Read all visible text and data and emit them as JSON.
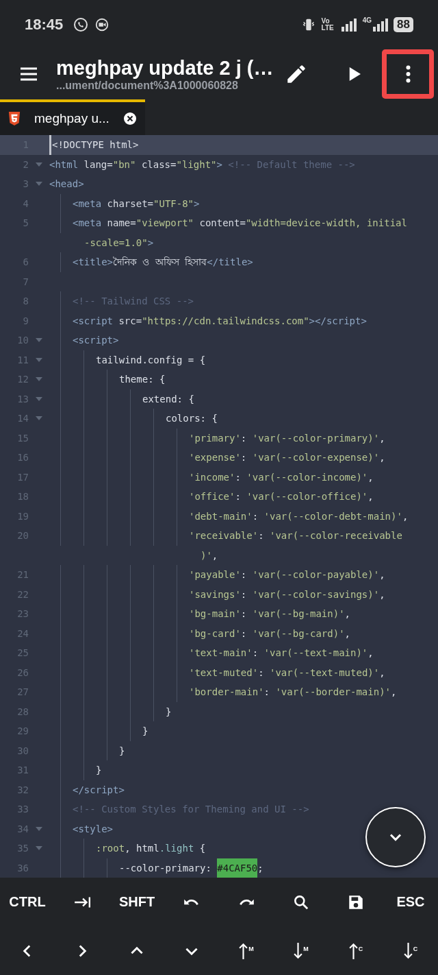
{
  "status_bar": {
    "time": "18:45",
    "volte_top": "Vo",
    "volte_bottom": "LTE",
    "network": "4G",
    "battery": "88"
  },
  "app_bar": {
    "title": "meghpay update 2 j (…",
    "subtitle": "...ument/document%3A1000060828",
    "menu_button_highlighted": true
  },
  "tabs": [
    {
      "label": "meghpay u...",
      "selected": true
    }
  ],
  "lines": [
    {
      "number": "1",
      "foldable": false,
      "current": true,
      "tokens": [
        {
          "kind": "p",
          "text": "<!DOCTYPE html>"
        }
      ]
    },
    {
      "number": "2",
      "foldable": true,
      "current": false,
      "tokens": [
        {
          "kind": "t",
          "text": "<html"
        },
        {
          "kind": "a",
          "text": " lang"
        },
        {
          "kind": "p",
          "text": "="
        },
        {
          "kind": "s",
          "text": "\"bn\""
        },
        {
          "kind": "a",
          "text": " class"
        },
        {
          "kind": "p",
          "text": "="
        },
        {
          "kind": "s",
          "text": "\"light\""
        },
        {
          "kind": "t",
          "text": ">"
        },
        {
          "kind": "c",
          "text": " <!-- Default theme -->"
        }
      ]
    },
    {
      "number": "3",
      "foldable": true,
      "current": false,
      "tokens": [
        {
          "kind": "t",
          "text": "<head>"
        }
      ],
      "children": [
        {
          "number": "4",
          "foldable": false,
          "current": false,
          "tokens": [
            {
              "kind": "t",
              "text": "<meta"
            },
            {
              "kind": "a",
              "text": " charset"
            },
            {
              "kind": "p",
              "text": "="
            },
            {
              "kind": "s",
              "text": "\"UTF-8\""
            },
            {
              "kind": "t",
              "text": ">"
            }
          ]
        },
        {
          "number": "5",
          "foldable": false,
          "current": false,
          "tokens": [
            {
              "kind": "t",
              "text": "<meta"
            },
            {
              "kind": "a",
              "text": " name"
            },
            {
              "kind": "p",
              "text": "="
            },
            {
              "kind": "s",
              "text": "\"viewport\""
            },
            {
              "kind": "a",
              "text": " content"
            },
            {
              "kind": "p",
              "text": "="
            },
            {
              "kind": "s",
              "text": "\"width=device-width, initial"
            }
          ],
          "continuation": [
            {
              "kind": "s",
              "text": "-scale=1.0\""
            },
            {
              "kind": "t",
              "text": ">"
            }
          ]
        },
        {
          "number": "6",
          "foldable": false,
          "current": false,
          "tokens": [
            {
              "kind": "t",
              "text": "<title>"
            },
            {
              "kind": "p",
              "text": "দৈনিক ও অফিস হিসাব"
            },
            {
              "kind": "t",
              "text": "</title>"
            }
          ]
        },
        {
          "number": "7",
          "foldable": false,
          "current": false
        },
        {
          "number": "8",
          "foldable": false,
          "current": false,
          "tokens": [
            {
              "kind": "c",
              "text": "<!-- Tailwind CSS -->"
            }
          ]
        },
        {
          "number": "9",
          "foldable": false,
          "current": false,
          "tokens": [
            {
              "kind": "t",
              "text": "<script"
            },
            {
              "kind": "a",
              "text": " src"
            },
            {
              "kind": "p",
              "text": "="
            },
            {
              "kind": "s",
              "text": "\"https://cdn.tailwindcss.com\""
            },
            {
              "kind": "t",
              "text": "></script>"
            }
          ]
        },
        {
          "number": "10",
          "foldable": true,
          "current": false,
          "tokens": [
            {
              "kind": "t",
              "text": "<script>"
            }
          ],
          "children": [
            {
              "number": "11",
              "foldable": true,
              "current": false,
              "tokens": [
                {
                  "kind": "p",
                  "text": "tailwind.config = {"
                }
              ],
              "children": [
                {
                  "number": "12",
                  "foldable": true,
                  "current": false,
                  "tokens": [
                    {
                      "kind": "p",
                      "text": "theme: {"
                    }
                  ],
                  "children": [
                    {
                      "number": "13",
                      "foldable": true,
                      "current": false,
                      "tokens": [
                        {
                          "kind": "p",
                          "text": "extend: {"
                        }
                      ],
                      "children": [
                        {
                          "number": "14",
                          "foldable": true,
                          "current": false,
                          "tokens": [
                            {
                              "kind": "p",
                              "text": "colors: {"
                            }
                          ],
                          "children": [
                            {
                              "number": "15",
                              "foldable": false,
                              "current": false,
                              "tokens": [
                                {
                                  "kind": "s",
                                  "text": "'primary'"
                                },
                                {
                                  "kind": "p",
                                  "text": ": "
                                },
                                {
                                  "kind": "s",
                                  "text": "'var(--color-primary)'"
                                },
                                {
                                  "kind": "p",
                                  "text": ","
                                }
                              ]
                            },
                            {
                              "number": "16",
                              "foldable": false,
                              "current": false,
                              "tokens": [
                                {
                                  "kind": "s",
                                  "text": "'expense'"
                                },
                                {
                                  "kind": "p",
                                  "text": ": "
                                },
                                {
                                  "kind": "s",
                                  "text": "'var(--color-expense)'"
                                },
                                {
                                  "kind": "p",
                                  "text": ","
                                }
                              ]
                            },
                            {
                              "number": "17",
                              "foldable": false,
                              "current": false,
                              "tokens": [
                                {
                                  "kind": "s",
                                  "text": "'income'"
                                },
                                {
                                  "kind": "p",
                                  "text": ": "
                                },
                                {
                                  "kind": "s",
                                  "text": "'var(--color-income)'"
                                },
                                {
                                  "kind": "p",
                                  "text": ","
                                }
                              ]
                            },
                            {
                              "number": "18",
                              "foldable": false,
                              "current": false,
                              "tokens": [
                                {
                                  "kind": "s",
                                  "text": "'office'"
                                },
                                {
                                  "kind": "p",
                                  "text": ": "
                                },
                                {
                                  "kind": "s",
                                  "text": "'var(--color-office)'"
                                },
                                {
                                  "kind": "p",
                                  "text": ","
                                }
                              ]
                            },
                            {
                              "number": "19",
                              "foldable": false,
                              "current": false,
                              "tokens": [
                                {
                                  "kind": "s",
                                  "text": "'debt-main'"
                                },
                                {
                                  "kind": "p",
                                  "text": ": "
                                },
                                {
                                  "kind": "s",
                                  "text": "'var(--color-debt-main)'"
                                },
                                {
                                  "kind": "p",
                                  "text": ","
                                }
                              ]
                            },
                            {
                              "number": "20",
                              "foldable": false,
                              "current": false,
                              "tokens": [
                                {
                                  "kind": "s",
                                  "text": "'receivable'"
                                },
                                {
                                  "kind": "p",
                                  "text": ": "
                                },
                                {
                                  "kind": "s",
                                  "text": "'var(--color-receivable"
                                }
                              ],
                              "continuation": [
                                {
                                  "kind": "s",
                                  "text": ")'"
                                },
                                {
                                  "kind": "p",
                                  "text": ","
                                }
                              ]
                            },
                            {
                              "number": "21",
                              "foldable": false,
                              "current": false,
                              "tokens": [
                                {
                                  "kind": "s",
                                  "text": "'payable'"
                                },
                                {
                                  "kind": "p",
                                  "text": ": "
                                },
                                {
                                  "kind": "s",
                                  "text": "'var(--color-payable)'"
                                },
                                {
                                  "kind": "p",
                                  "text": ","
                                }
                              ]
                            },
                            {
                              "number": "22",
                              "foldable": false,
                              "current": false,
                              "tokens": [
                                {
                                  "kind": "s",
                                  "text": "'savings'"
                                },
                                {
                                  "kind": "p",
                                  "text": ": "
                                },
                                {
                                  "kind": "s",
                                  "text": "'var(--color-savings)'"
                                },
                                {
                                  "kind": "p",
                                  "text": ","
                                }
                              ]
                            },
                            {
                              "number": "23",
                              "foldable": false,
                              "current": false,
                              "tokens": [
                                {
                                  "kind": "s",
                                  "text": "'bg-main'"
                                },
                                {
                                  "kind": "p",
                                  "text": ": "
                                },
                                {
                                  "kind": "s",
                                  "text": "'var(--bg-main)'"
                                },
                                {
                                  "kind": "p",
                                  "text": ","
                                }
                              ]
                            },
                            {
                              "number": "24",
                              "foldable": false,
                              "current": false,
                              "tokens": [
                                {
                                  "kind": "s",
                                  "text": "'bg-card'"
                                },
                                {
                                  "kind": "p",
                                  "text": ": "
                                },
                                {
                                  "kind": "s",
                                  "text": "'var(--bg-card)'"
                                },
                                {
                                  "kind": "p",
                                  "text": ","
                                }
                              ]
                            },
                            {
                              "number": "25",
                              "foldable": false,
                              "current": false,
                              "tokens": [
                                {
                                  "kind": "s",
                                  "text": "'text-main'"
                                },
                                {
                                  "kind": "p",
                                  "text": ": "
                                },
                                {
                                  "kind": "s",
                                  "text": "'var(--text-main)'"
                                },
                                {
                                  "kind": "p",
                                  "text": ","
                                }
                              ]
                            },
                            {
                              "number": "26",
                              "foldable": false,
                              "current": false,
                              "tokens": [
                                {
                                  "kind": "s",
                                  "text": "'text-muted'"
                                },
                                {
                                  "kind": "p",
                                  "text": ": "
                                },
                                {
                                  "kind": "s",
                                  "text": "'var(--text-muted)'"
                                },
                                {
                                  "kind": "p",
                                  "text": ","
                                }
                              ]
                            },
                            {
                              "number": "27",
                              "foldable": false,
                              "current": false,
                              "tokens": [
                                {
                                  "kind": "s",
                                  "text": "'border-main'"
                                },
                                {
                                  "kind": "p",
                                  "text": ": "
                                },
                                {
                                  "kind": "s",
                                  "text": "'var(--border-main)'"
                                },
                                {
                                  "kind": "p",
                                  "text": ","
                                }
                              ]
                            }
                          ]
                        },
                        {
                          "number": "28",
                          "foldable": false,
                          "current": false,
                          "tokens": [
                            {
                              "kind": "p",
                              "text": "}"
                            }
                          ]
                        }
                      ]
                    },
                    {
                      "number": "29",
                      "foldable": false,
                      "current": false,
                      "tokens": [
                        {
                          "kind": "p",
                          "text": "}"
                        }
                      ]
                    }
                  ]
                },
                {
                  "number": "30",
                  "foldable": false,
                  "current": false,
                  "tokens": [
                    {
                      "kind": "p",
                      "text": "}"
                    }
                  ]
                }
              ]
            },
            {
              "number": "31",
              "foldable": false,
              "current": false,
              "tokens": [
                {
                  "kind": "p",
                  "text": "}"
                }
              ]
            }
          ]
        },
        {
          "number": "32",
          "foldable": false,
          "current": false,
          "tokens": [
            {
              "kind": "t",
              "text": "</script>"
            }
          ]
        },
        {
          "number": "33",
          "foldable": false,
          "current": false,
          "tokens": [
            {
              "kind": "c",
              "text": "<!-- Custom Styles for Theming and UI -->"
            }
          ]
        },
        {
          "number": "34",
          "foldable": true,
          "current": false,
          "tokens": [
            {
              "kind": "t",
              "text": "<style>"
            }
          ],
          "children": [
            {
              "number": "35",
              "foldable": true,
              "current": false,
              "tokens": [
                {
                  "kind": "k",
                  "text": ":root"
                },
                {
                  "kind": "p",
                  "text": ", html"
                },
                {
                  "kind": "n",
                  "text": ".light"
                },
                {
                  "kind": "p",
                  "text": " {"
                }
              ],
              "children": [
                {
                  "number": "36",
                  "foldable": false,
                  "current": false,
                  "tokens": [
                    {
                      "kind": "p",
                      "text": "--color-primary: "
                    },
                    {
                      "kind": "h",
                      "text": "#4CAF50"
                    },
                    {
                      "kind": "p",
                      "text": ";"
                    }
                  ]
                }
              ]
            }
          ]
        }
      ]
    }
  ],
  "key_rows": [
    [
      {
        "kind": "text",
        "label": "CTRL"
      },
      {
        "kind": "icon"
      },
      {
        "kind": "text",
        "label": "SHFT"
      },
      {
        "kind": "icon"
      },
      {
        "kind": "icon"
      },
      {
        "kind": "icon"
      },
      {
        "kind": "icon"
      },
      {
        "kind": "text",
        "label": "ESC"
      }
    ],
    [
      {
        "kind": "icon"
      },
      {
        "kind": "icon"
      },
      {
        "kind": "icon"
      },
      {
        "kind": "icon"
      },
      {
        "kind": "icon",
        "sub": "M"
      },
      {
        "kind": "icon",
        "sub": "M"
      },
      {
        "kind": "icon",
        "sub": "C"
      },
      {
        "kind": "icon",
        "sub": "C"
      }
    ]
  ]
}
